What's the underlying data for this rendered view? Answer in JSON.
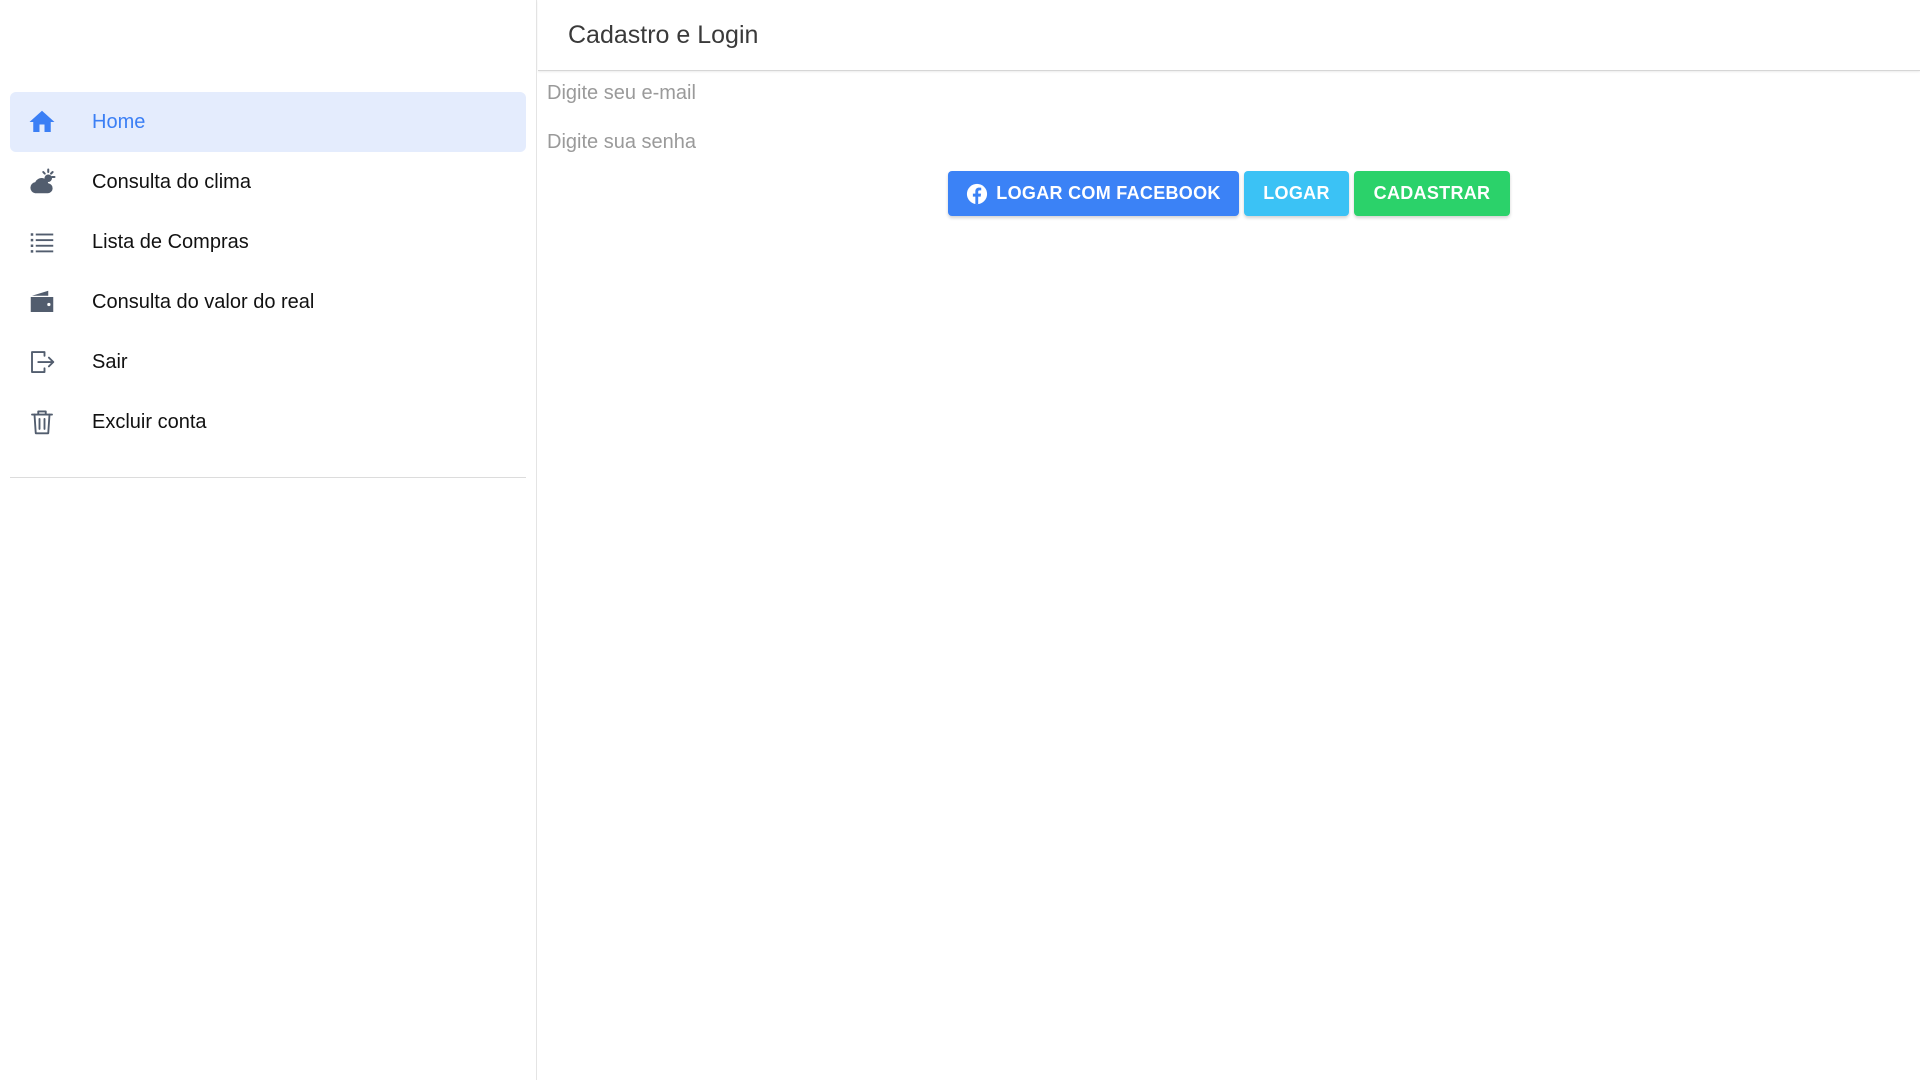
{
  "sidebar": {
    "items": [
      {
        "label": "Home",
        "icon": "home-icon",
        "active": true
      },
      {
        "label": "Consulta do clima",
        "icon": "cloud-sun-icon",
        "active": false
      },
      {
        "label": "Lista de Compras",
        "icon": "list-icon",
        "active": false
      },
      {
        "label": "Consulta do valor do real",
        "icon": "wallet-icon",
        "active": false
      },
      {
        "label": "Sair",
        "icon": "logout-icon",
        "active": false
      },
      {
        "label": "Excluir conta",
        "icon": "trash-icon",
        "active": false
      }
    ]
  },
  "header": {
    "title": "Cadastro e Login"
  },
  "form": {
    "email": {
      "placeholder": "Digite seu e-mail",
      "value": ""
    },
    "password": {
      "placeholder": "Digite sua senha",
      "value": ""
    }
  },
  "actions": {
    "facebook_label": "LOGAR COM FACEBOOK",
    "login_label": "LOGAR",
    "register_label": "CADASTRAR"
  },
  "colors": {
    "accent": "#3b7ff5",
    "active_bg": "#e4ecfd",
    "facebook_button": "#3b82f6",
    "login_button": "#3bc2f5",
    "register_button": "#2bd26a",
    "icon_gray": "#525d6e"
  }
}
